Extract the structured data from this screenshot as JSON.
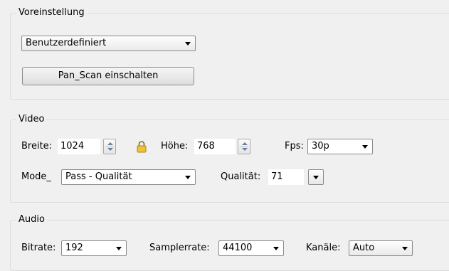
{
  "preset": {
    "legend": "Voreinstellung",
    "select_value": "Benutzerdefiniert",
    "panscan_button": "Pan_Scan einschalten"
  },
  "video": {
    "legend": "Video",
    "width_label": "Breite:",
    "width_value": "1024",
    "height_label": "Höhe:",
    "height_value": "768",
    "fps_label": "Fps:",
    "fps_value": "30p",
    "mode_label": "Mode_",
    "mode_value": "Pass - Qualität",
    "quality_label": "Qualität:",
    "quality_value": "71"
  },
  "audio": {
    "legend": "Audio",
    "bitrate_label": "Bitrate:",
    "bitrate_value": "192",
    "samplerate_label": "Samplerrate:",
    "samplerate_value": "44100",
    "channels_label": "Kanäle:",
    "channels_value": "Auto"
  },
  "icons": {
    "lock": "lock-icon"
  }
}
